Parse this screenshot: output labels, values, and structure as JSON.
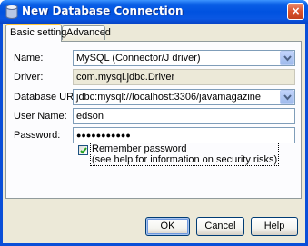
{
  "window": {
    "title": "New Database Connection",
    "close_label": "×"
  },
  "tabs": [
    {
      "label": "Basic setting",
      "active": true
    },
    {
      "label": "Advanced",
      "active": false
    }
  ],
  "form": {
    "name": {
      "label": "Name:",
      "value": "MySQL (Connector/J driver)"
    },
    "driver": {
      "label": "Driver:",
      "value": "com.mysql.jdbc.Driver"
    },
    "database_url": {
      "label": "Database URL:",
      "value": "jdbc:mysql://localhost:3306/javamagazine"
    },
    "user_name": {
      "label": "User Name:",
      "value": "edson"
    },
    "password": {
      "label": "Password:",
      "value": "●●●●●●●●●●●"
    },
    "remember": {
      "checked": true,
      "line1": "Remember password",
      "line2": "(see help for information on security risks)"
    }
  },
  "buttons": {
    "ok": "OK",
    "cancel": "Cancel",
    "help": "Help"
  },
  "colors": {
    "titlebar": "#0052e0",
    "dialog_bg": "#ece9d8",
    "close_button": "#d9522c",
    "tab_highlight": "#ffc83c"
  }
}
